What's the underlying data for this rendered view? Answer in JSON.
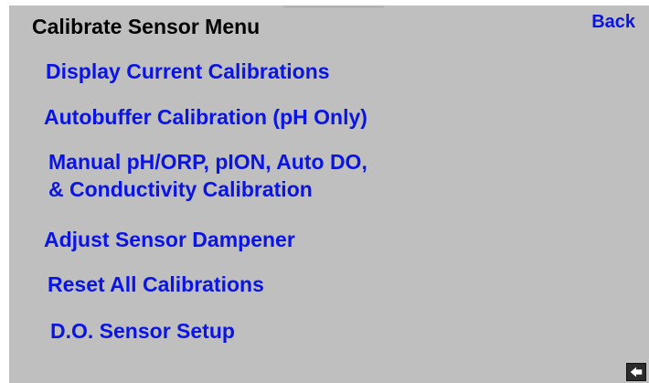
{
  "header": {
    "title": "Calibrate Sensor Menu",
    "back_label": "Back"
  },
  "menu": {
    "items": [
      {
        "label": "Display Current Calibrations"
      },
      {
        "label": "Autobuffer Calibration (pH Only)"
      },
      {
        "label_line1": "Manual pH/ORP, pION, Auto DO,",
        "label_line2": "& Conductivity Calibration"
      },
      {
        "label": "Adjust Sensor Dampener"
      },
      {
        "label": "Reset All Calibrations"
      },
      {
        "label": "D.O. Sensor Setup"
      }
    ]
  },
  "footer": {
    "back_arrow_icon": "arrow-left-icon"
  },
  "colors": {
    "background": "#bfbfbf",
    "link": "#0a14e6",
    "title": "#000000"
  }
}
